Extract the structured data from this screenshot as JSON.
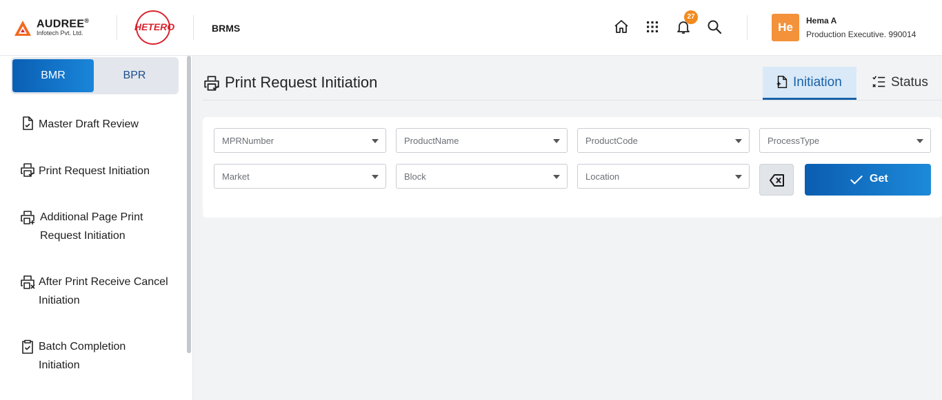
{
  "header": {
    "brand_name": "AUDREE",
    "brand_mark": "®",
    "brand_sub": "Infotech Pvt. Ltd.",
    "partner_logo": "HETERO",
    "app_name": "BRMS",
    "notification_count": "27",
    "icons": [
      "home-icon",
      "apps-grid-icon",
      "bell-icon",
      "search-icon"
    ],
    "user": {
      "initials": "He",
      "name": "Hema A",
      "role": "Production Executive. 990014",
      "avatar_color": "#f3923a"
    }
  },
  "sidebar": {
    "segments": [
      {
        "label": "BMR",
        "active": true
      },
      {
        "label": "BPR",
        "active": false
      }
    ],
    "items": [
      {
        "label": "Master Draft Review",
        "icon": "document-check-icon"
      },
      {
        "label": "Print Request Initiation",
        "icon": "printer-check-icon"
      },
      {
        "label_line1": "Additional Page Print",
        "label_line2": "Request Initiation",
        "icon": "printer-plus-icon"
      },
      {
        "label_line1": "After Print Receive Cancel",
        "label_line2": "Initiation",
        "icon": "printer-x-icon"
      },
      {
        "label_line1": "Batch Completion",
        "label_line2": "Initiation",
        "icon": "clipboard-check-icon"
      }
    ]
  },
  "main": {
    "title": "Print Request Initiation",
    "tabs": [
      {
        "label": "Initiation",
        "active": true
      },
      {
        "label": "Status",
        "active": false
      }
    ],
    "filters": {
      "mpr_number": "MPRNumber",
      "product_name": "ProductName",
      "product_code": "ProductCode",
      "process_type": "ProcessType",
      "market": "Market",
      "block": "Block",
      "location": "Location"
    },
    "get_label": "Get"
  },
  "colors": {
    "accent": "#1761a8",
    "primary_gradient_start": "#0b5db1",
    "primary_gradient_end": "#1d8ad9",
    "badge": "#f28a1f",
    "hetero_red": "#d9232e"
  }
}
